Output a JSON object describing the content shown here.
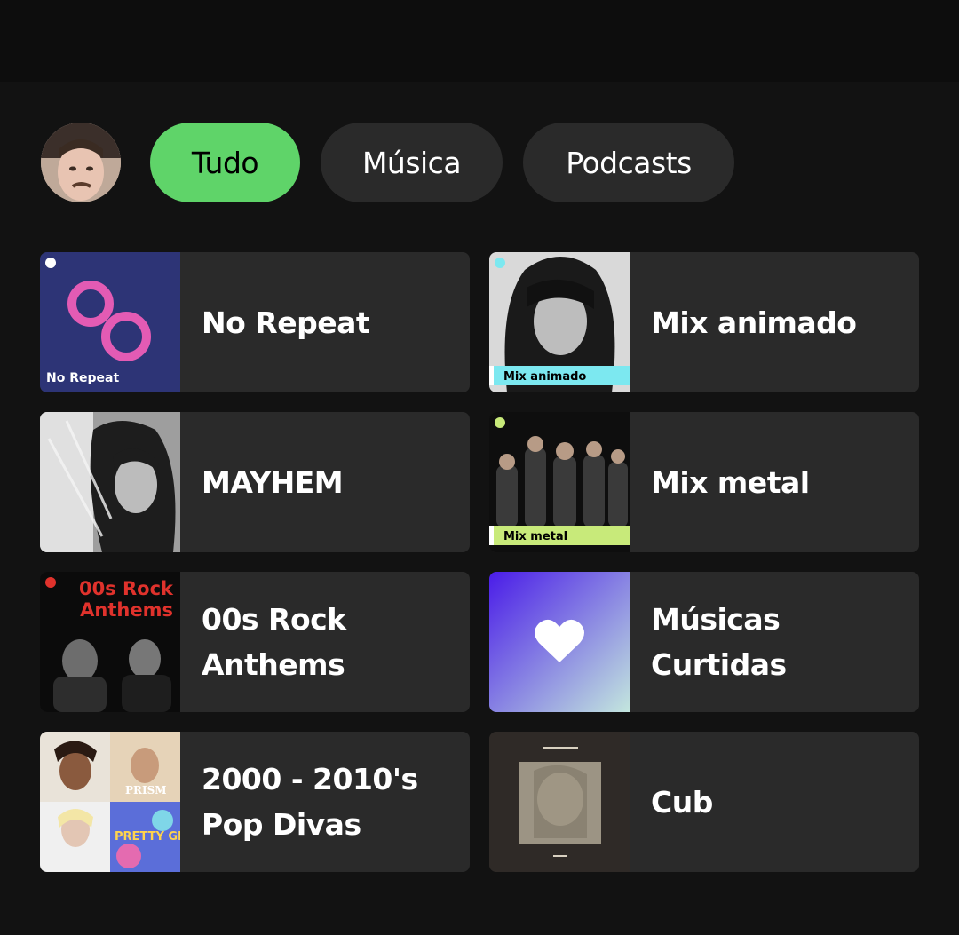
{
  "filters": {
    "chips": [
      {
        "label": "Tudo",
        "active": true
      },
      {
        "label": "Música",
        "active": false
      },
      {
        "label": "Podcasts",
        "active": false
      }
    ]
  },
  "shortcuts": [
    {
      "title": "No Repeat",
      "cover_text": "No Repeat",
      "cover_bg": "#2d3476",
      "accent": "#e35bb4"
    },
    {
      "title": "Mix animado",
      "cover_text": "Mix animado",
      "accent": "#7ce8f0"
    },
    {
      "title": "MAYHEM"
    },
    {
      "title": "Mix metal",
      "cover_text": "Mix metal",
      "accent": "#c8ea7a"
    },
    {
      "title": "00s Rock Anthems",
      "cover_line1": "00s Rock",
      "cover_line2": "Anthems",
      "accent": "#e0322c"
    },
    {
      "title": "Músicas Curtidas",
      "icon": "heart-icon",
      "gradient": [
        "#4a1ce8",
        "#c3e6de"
      ]
    },
    {
      "title": "2000 - 2010's Pop Divas"
    },
    {
      "title": "Cub"
    }
  ]
}
